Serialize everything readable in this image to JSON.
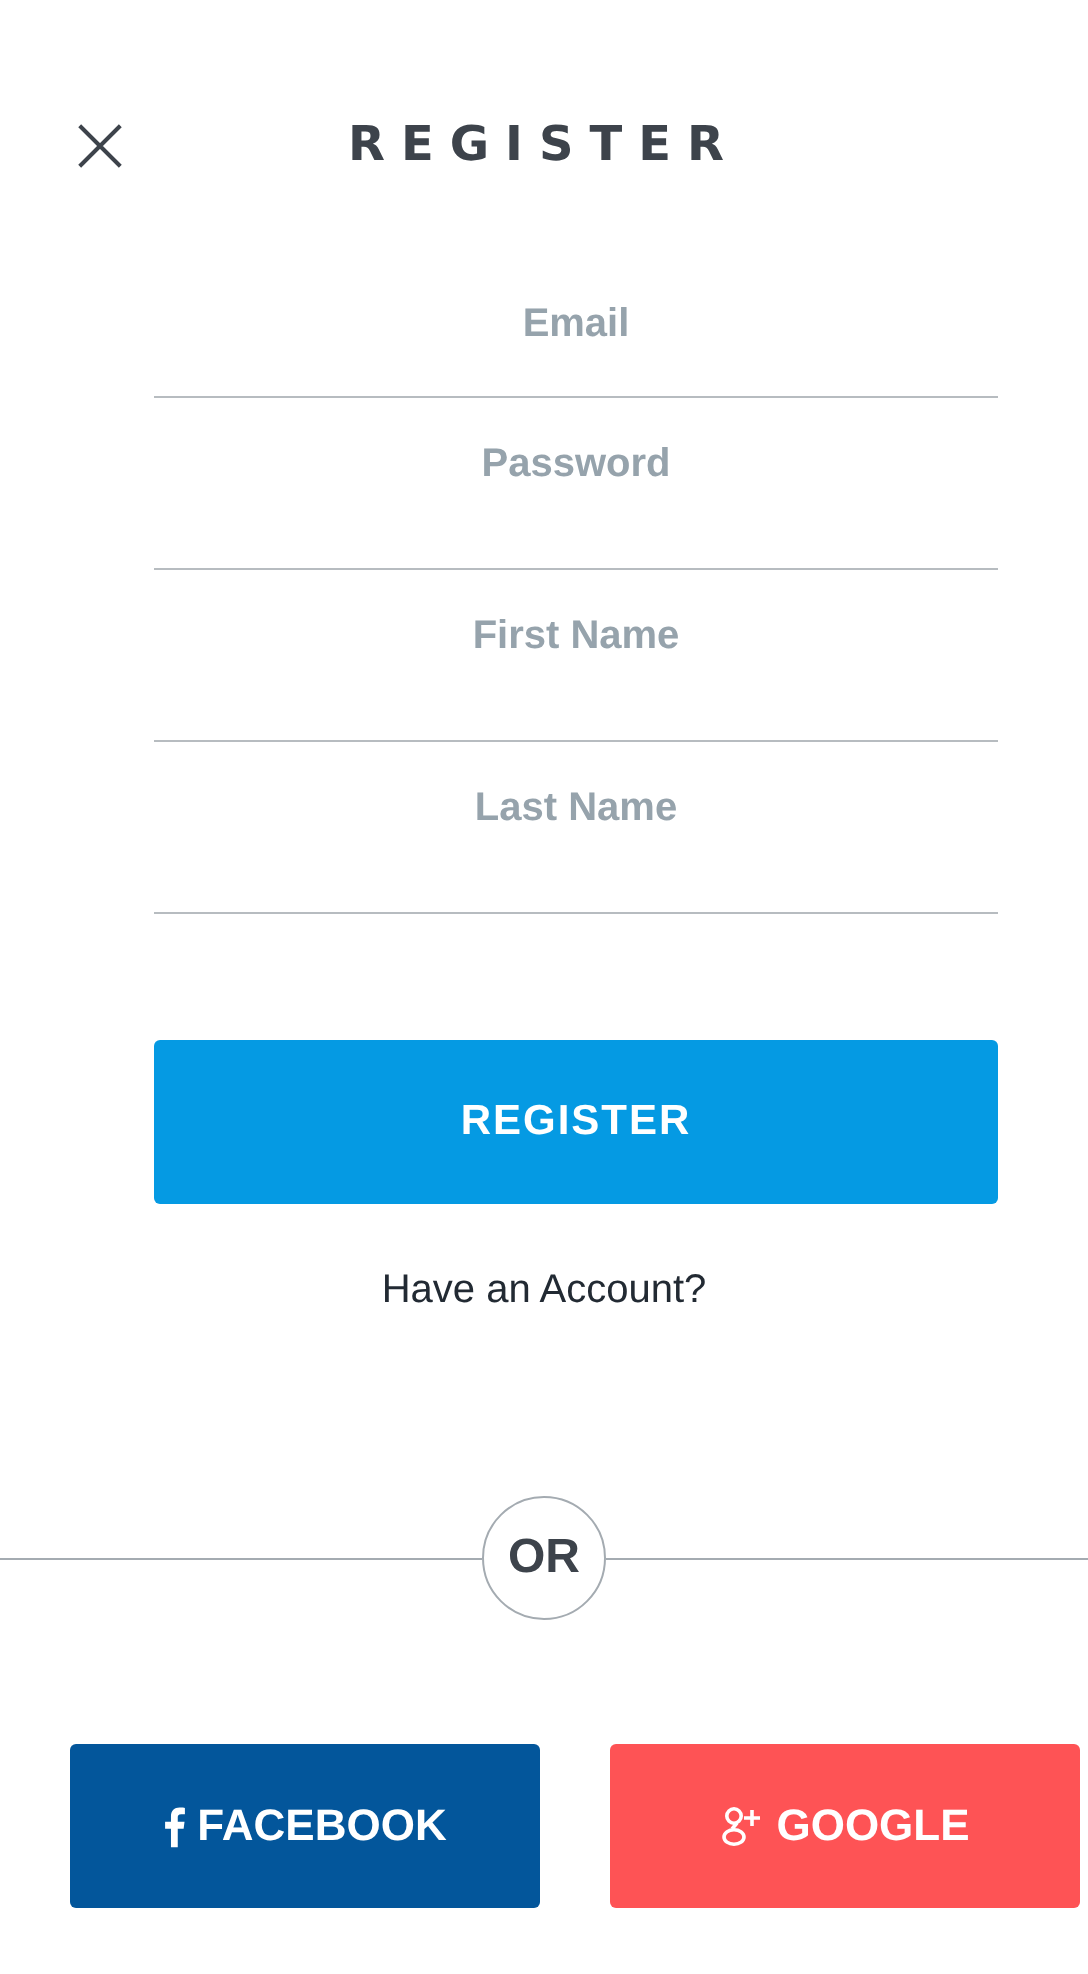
{
  "header": {
    "title": "REGISTER"
  },
  "fields": [
    {
      "placeholder": "Email"
    },
    {
      "placeholder": "Password"
    },
    {
      "placeholder": "First Name"
    },
    {
      "placeholder": "Last Name"
    }
  ],
  "register_button": "REGISTER",
  "account_link": "Have an Account?",
  "divider": "OR",
  "social_buttons": [
    {
      "kind": "facebook",
      "label": "FACEBOOK",
      "color": "#03569b"
    },
    {
      "kind": "google",
      "label": "GOOGLE",
      "color": "#fe5355"
    }
  ]
}
